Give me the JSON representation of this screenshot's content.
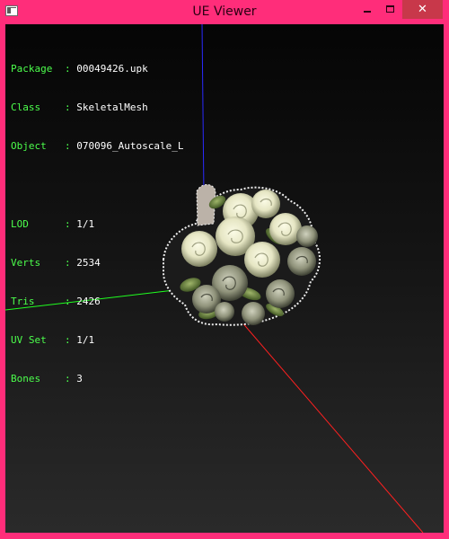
{
  "window": {
    "title": "UE Viewer",
    "icon": "ue-viewer-app-icon",
    "controls": {
      "minimize_icon": "minimize-icon",
      "maximize_icon": "maximize-icon",
      "close_icon": "close-icon",
      "close_glyph": "✕"
    },
    "accent_color": "#ff2d7a",
    "close_color": "#c8384a"
  },
  "info": {
    "package": {
      "label": "Package",
      "value": "00049426.upk"
    },
    "class": {
      "label": "Class",
      "value": "SkeletalMesh"
    },
    "object": {
      "label": "Object",
      "value": "070096_Autoscale_L"
    },
    "lod": {
      "label": "LOD",
      "value": "1/1"
    },
    "verts": {
      "label": "Verts",
      "value": "2534"
    },
    "tris": {
      "label": "Tris",
      "value": "2426"
    },
    "uvset": {
      "label": "UV Set",
      "value": "1/1"
    },
    "bones": {
      "label": "Bones",
      "value": "3"
    }
  },
  "colors": {
    "label_text": "#4cff4c",
    "value_text": "#ffffff",
    "axis_x": "#ff2020",
    "axis_y": "#20ff20",
    "axis_z": "#2020ff"
  },
  "viewport": {
    "model": "rose-bouquet-mesh"
  }
}
